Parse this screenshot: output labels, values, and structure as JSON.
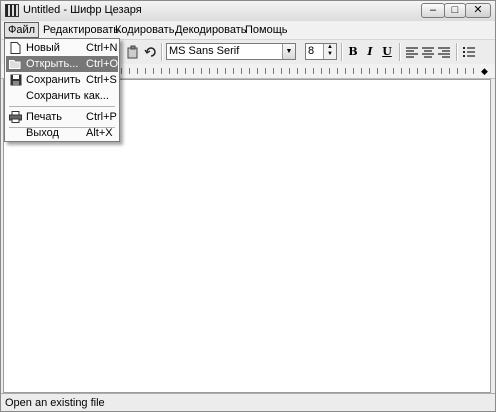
{
  "window": {
    "title": "Untitled - Шифр Цезаря",
    "app_icon": "cipher-app-icon",
    "controls": {
      "minimize": "–",
      "maximize": "□",
      "close": "✕"
    }
  },
  "menubar": {
    "items": [
      {
        "label": "Файл",
        "state": "open"
      },
      {
        "label": "Редактировать"
      },
      {
        "label": "Кодировать"
      },
      {
        "label": "Декодировать"
      },
      {
        "label": "Помощь"
      }
    ]
  },
  "file_menu": {
    "items": [
      {
        "label": "Новый",
        "shortcut": "Ctrl+N",
        "icon": "new-file-icon"
      },
      {
        "label": "Открыть...",
        "shortcut": "Ctrl+O",
        "icon": "open-folder-icon",
        "highlighted": true
      },
      {
        "label": "Сохранить",
        "shortcut": "Ctrl+S",
        "icon": "save-icon"
      },
      {
        "label": "Сохранить как..."
      },
      {
        "label": "Печать",
        "shortcut": "Ctrl+P",
        "icon": "print-icon"
      },
      {
        "label": "Выход",
        "shortcut": "Alt+X"
      }
    ]
  },
  "toolbar": {
    "font_name": "MS Sans Serif",
    "font_size": "8",
    "bold": "B",
    "italic": "I",
    "underline": "U",
    "icons": [
      "paste-icon",
      "undo-icon",
      "align-left-icon",
      "align-center-icon",
      "align-right-icon",
      "bullets-icon"
    ]
  },
  "status": {
    "text": "Open an existing file"
  },
  "colors": {
    "menu_highlight": "#777777",
    "document": "#ffffff",
    "chrome": "#ececec"
  }
}
